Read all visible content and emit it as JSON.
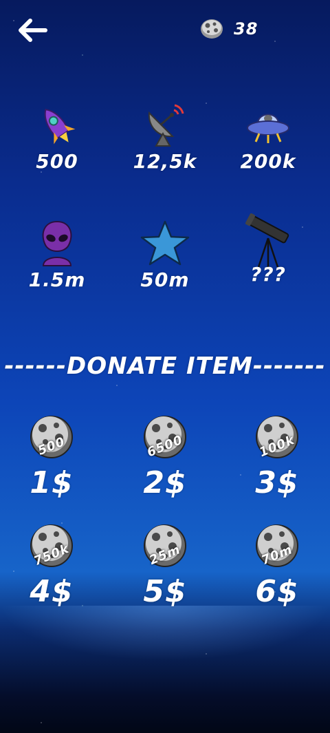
{
  "hud": {
    "back_icon": "back-arrow-icon",
    "coin_icon": "meteor-coin-icon",
    "coins": "38"
  },
  "shop": [
    {
      "icon": "rocket-icon",
      "price": "500"
    },
    {
      "icon": "satellite-dish-icon",
      "price": "12,5k"
    },
    {
      "icon": "ufo-icon",
      "price": "200k"
    },
    {
      "icon": "alien-icon",
      "price": "1.5m"
    },
    {
      "icon": "star-icon",
      "price": "50m"
    },
    {
      "icon": "telescope-icon",
      "price": "???"
    }
  ],
  "donate": {
    "title": "------DONATE ITEM-------",
    "items": [
      {
        "amount": "500",
        "price": "1$"
      },
      {
        "amount": "6500",
        "price": "2$"
      },
      {
        "amount": "100k",
        "price": "3$"
      },
      {
        "amount": "750k",
        "price": "4$"
      },
      {
        "amount": "25m",
        "price": "5$"
      },
      {
        "amount": "70m",
        "price": "6$"
      }
    ]
  },
  "colors": {
    "background_top": "#061a5e",
    "background_mid": "#0d45b8",
    "rocket": "#8a3fd0",
    "alien": "#7a2fa8",
    "star": "#3a97d8",
    "ufo": "#5b6fd6"
  }
}
